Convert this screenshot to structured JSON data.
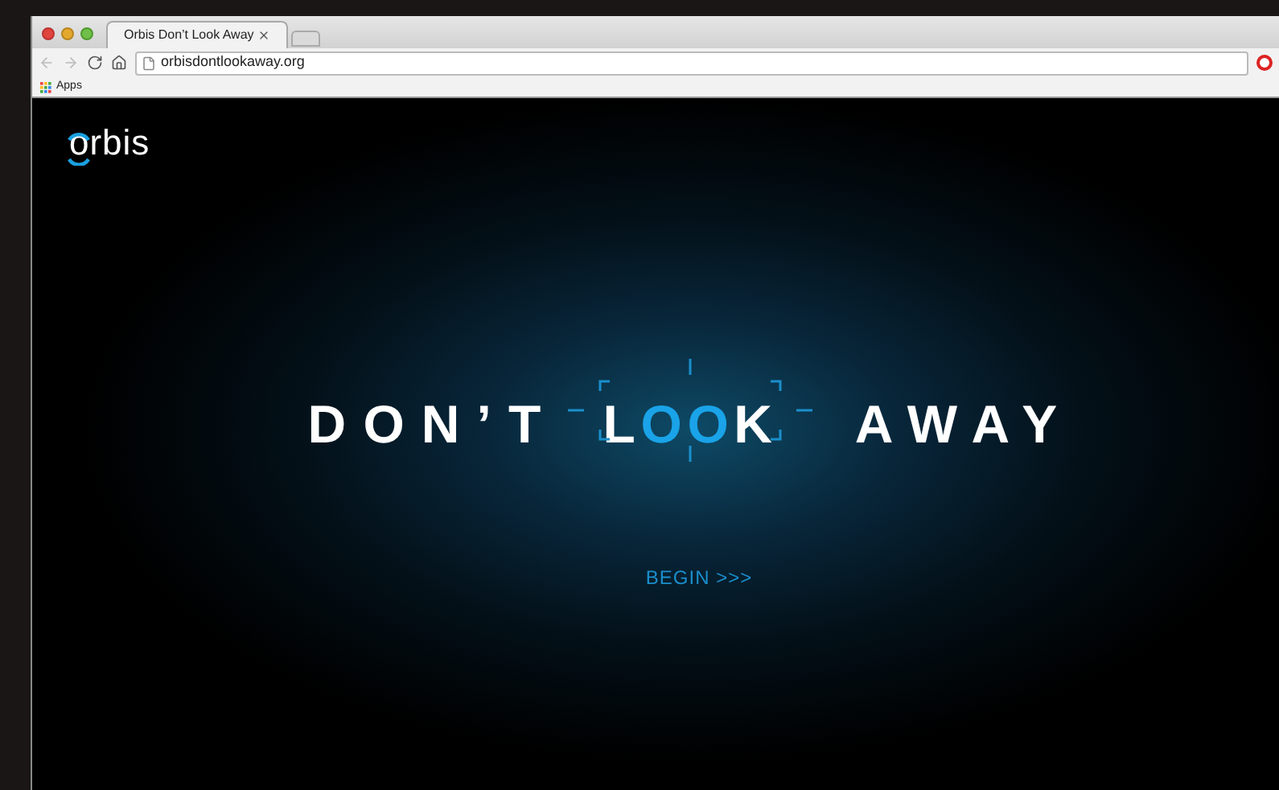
{
  "browser": {
    "tab": {
      "title": "Orbis Don’t Look Away",
      "selected": true
    },
    "address": "orbisdontlookaway.org",
    "bookmarks": [
      {
        "label": "Apps"
      }
    ]
  },
  "page": {
    "logo": "orbis",
    "headline": {
      "before": "DON’T",
      "focus": [
        {
          "text": "L",
          "highlighted": false
        },
        {
          "text": "OO",
          "highlighted": true
        },
        {
          "text": "K",
          "highlighted": false
        }
      ],
      "after": "AWAY"
    },
    "link": "BEGIN >>>"
  }
}
